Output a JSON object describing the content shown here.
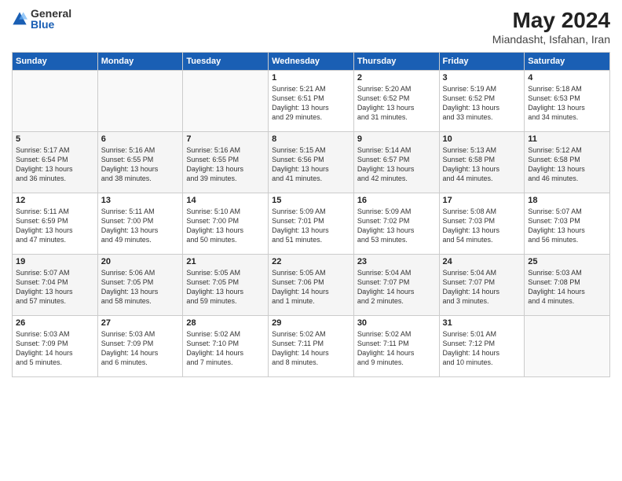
{
  "logo": {
    "general": "General",
    "blue": "Blue"
  },
  "title": "May 2024",
  "subtitle": "Miandasht, Isfahan, Iran",
  "days_of_week": [
    "Sunday",
    "Monday",
    "Tuesday",
    "Wednesday",
    "Thursday",
    "Friday",
    "Saturday"
  ],
  "weeks": [
    [
      {
        "day": "",
        "info": ""
      },
      {
        "day": "",
        "info": ""
      },
      {
        "day": "",
        "info": ""
      },
      {
        "day": "1",
        "info": "Sunrise: 5:21 AM\nSunset: 6:51 PM\nDaylight: 13 hours\nand 29 minutes."
      },
      {
        "day": "2",
        "info": "Sunrise: 5:20 AM\nSunset: 6:52 PM\nDaylight: 13 hours\nand 31 minutes."
      },
      {
        "day": "3",
        "info": "Sunrise: 5:19 AM\nSunset: 6:52 PM\nDaylight: 13 hours\nand 33 minutes."
      },
      {
        "day": "4",
        "info": "Sunrise: 5:18 AM\nSunset: 6:53 PM\nDaylight: 13 hours\nand 34 minutes."
      }
    ],
    [
      {
        "day": "5",
        "info": "Sunrise: 5:17 AM\nSunset: 6:54 PM\nDaylight: 13 hours\nand 36 minutes."
      },
      {
        "day": "6",
        "info": "Sunrise: 5:16 AM\nSunset: 6:55 PM\nDaylight: 13 hours\nand 38 minutes."
      },
      {
        "day": "7",
        "info": "Sunrise: 5:16 AM\nSunset: 6:55 PM\nDaylight: 13 hours\nand 39 minutes."
      },
      {
        "day": "8",
        "info": "Sunrise: 5:15 AM\nSunset: 6:56 PM\nDaylight: 13 hours\nand 41 minutes."
      },
      {
        "day": "9",
        "info": "Sunrise: 5:14 AM\nSunset: 6:57 PM\nDaylight: 13 hours\nand 42 minutes."
      },
      {
        "day": "10",
        "info": "Sunrise: 5:13 AM\nSunset: 6:58 PM\nDaylight: 13 hours\nand 44 minutes."
      },
      {
        "day": "11",
        "info": "Sunrise: 5:12 AM\nSunset: 6:58 PM\nDaylight: 13 hours\nand 46 minutes."
      }
    ],
    [
      {
        "day": "12",
        "info": "Sunrise: 5:11 AM\nSunset: 6:59 PM\nDaylight: 13 hours\nand 47 minutes."
      },
      {
        "day": "13",
        "info": "Sunrise: 5:11 AM\nSunset: 7:00 PM\nDaylight: 13 hours\nand 49 minutes."
      },
      {
        "day": "14",
        "info": "Sunrise: 5:10 AM\nSunset: 7:00 PM\nDaylight: 13 hours\nand 50 minutes."
      },
      {
        "day": "15",
        "info": "Sunrise: 5:09 AM\nSunset: 7:01 PM\nDaylight: 13 hours\nand 51 minutes."
      },
      {
        "day": "16",
        "info": "Sunrise: 5:09 AM\nSunset: 7:02 PM\nDaylight: 13 hours\nand 53 minutes."
      },
      {
        "day": "17",
        "info": "Sunrise: 5:08 AM\nSunset: 7:03 PM\nDaylight: 13 hours\nand 54 minutes."
      },
      {
        "day": "18",
        "info": "Sunrise: 5:07 AM\nSunset: 7:03 PM\nDaylight: 13 hours\nand 56 minutes."
      }
    ],
    [
      {
        "day": "19",
        "info": "Sunrise: 5:07 AM\nSunset: 7:04 PM\nDaylight: 13 hours\nand 57 minutes."
      },
      {
        "day": "20",
        "info": "Sunrise: 5:06 AM\nSunset: 7:05 PM\nDaylight: 13 hours\nand 58 minutes."
      },
      {
        "day": "21",
        "info": "Sunrise: 5:05 AM\nSunset: 7:05 PM\nDaylight: 13 hours\nand 59 minutes."
      },
      {
        "day": "22",
        "info": "Sunrise: 5:05 AM\nSunset: 7:06 PM\nDaylight: 14 hours\nand 1 minute."
      },
      {
        "day": "23",
        "info": "Sunrise: 5:04 AM\nSunset: 7:07 PM\nDaylight: 14 hours\nand 2 minutes."
      },
      {
        "day": "24",
        "info": "Sunrise: 5:04 AM\nSunset: 7:07 PM\nDaylight: 14 hours\nand 3 minutes."
      },
      {
        "day": "25",
        "info": "Sunrise: 5:03 AM\nSunset: 7:08 PM\nDaylight: 14 hours\nand 4 minutes."
      }
    ],
    [
      {
        "day": "26",
        "info": "Sunrise: 5:03 AM\nSunset: 7:09 PM\nDaylight: 14 hours\nand 5 minutes."
      },
      {
        "day": "27",
        "info": "Sunrise: 5:03 AM\nSunset: 7:09 PM\nDaylight: 14 hours\nand 6 minutes."
      },
      {
        "day": "28",
        "info": "Sunrise: 5:02 AM\nSunset: 7:10 PM\nDaylight: 14 hours\nand 7 minutes."
      },
      {
        "day": "29",
        "info": "Sunrise: 5:02 AM\nSunset: 7:11 PM\nDaylight: 14 hours\nand 8 minutes."
      },
      {
        "day": "30",
        "info": "Sunrise: 5:02 AM\nSunset: 7:11 PM\nDaylight: 14 hours\nand 9 minutes."
      },
      {
        "day": "31",
        "info": "Sunrise: 5:01 AM\nSunset: 7:12 PM\nDaylight: 14 hours\nand 10 minutes."
      },
      {
        "day": "",
        "info": ""
      }
    ]
  ]
}
